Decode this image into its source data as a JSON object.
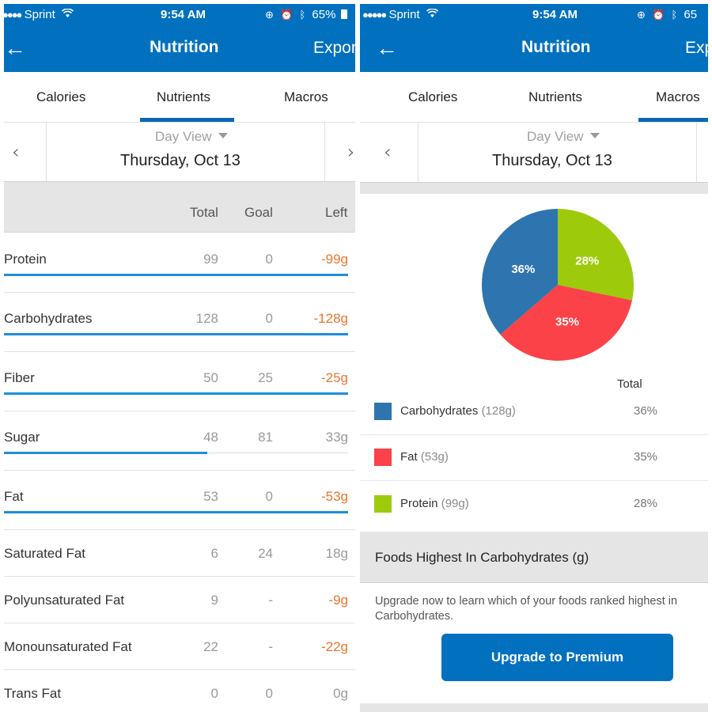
{
  "colors": {
    "brand": "#0070bf",
    "negative": "#e8762d",
    "progress": "#1e8ed8",
    "carbs": "#2e74ae",
    "fat": "#fb4248",
    "protein": "#9dcb0c"
  },
  "left_screen": {
    "status": {
      "signal_dots": "●●●●",
      "carrier": "Sprint",
      "time": "9:54 AM",
      "icons": [
        "rotation-lock-icon",
        "alarm-icon",
        "bluetooth-icon"
      ],
      "battery": "65%"
    },
    "nav": {
      "back_icon": "←",
      "title": "Nutrition",
      "action": "Expor"
    },
    "tabs": [
      {
        "label": "Calories",
        "active": false
      },
      {
        "label": "Nutrients",
        "active": true
      },
      {
        "label": "Macros",
        "active": false
      }
    ],
    "date_nav": {
      "prev": "‹",
      "next": "›",
      "view": "Day View",
      "date": "Thursday, Oct 13"
    },
    "table": {
      "headers": {
        "total": "Total",
        "goal": "Goal",
        "left": "Left"
      },
      "rows": [
        {
          "name": "Protein",
          "total": "99",
          "goal": "0",
          "left": "-99g",
          "over": true,
          "progress": 1.0,
          "bar": true
        },
        {
          "name": "Carbohydrates",
          "total": "128",
          "goal": "0",
          "left": "-128g",
          "over": true,
          "progress": 1.0,
          "bar": true
        },
        {
          "name": "Fiber",
          "total": "50",
          "goal": "25",
          "left": "-25g",
          "over": true,
          "progress": 1.0,
          "bar": true
        },
        {
          "name": "Sugar",
          "total": "48",
          "goal": "81",
          "left": "33g",
          "over": false,
          "progress": 0.59,
          "bar": true
        },
        {
          "name": "Fat",
          "total": "53",
          "goal": "0",
          "left": "-53g",
          "over": true,
          "progress": 1.0,
          "bar": true
        },
        {
          "name": "Saturated Fat",
          "total": "6",
          "goal": "24",
          "left": "18g",
          "over": false,
          "bar": false
        },
        {
          "name": "Polyunsaturated Fat",
          "total": "9",
          "goal": "-",
          "left": "-9g",
          "over": true,
          "bar": false
        },
        {
          "name": "Monounsaturated Fat",
          "total": "22",
          "goal": "-",
          "left": "-22g",
          "over": true,
          "bar": false
        },
        {
          "name": "Trans Fat",
          "total": "0",
          "goal": "0",
          "left": "0g",
          "over": false,
          "bar": false
        }
      ]
    }
  },
  "right_screen": {
    "status": {
      "signal_dots": "●●●●●",
      "carrier": "Sprint",
      "time": "9:54 AM",
      "icons": [
        "rotation-lock-icon",
        "alarm-icon",
        "bluetooth-icon"
      ],
      "battery": "65"
    },
    "nav": {
      "back_icon": "←",
      "title": "Nutrition",
      "action": "Exp"
    },
    "tabs": [
      {
        "label": "Calories",
        "active": false
      },
      {
        "label": "Nutrients",
        "active": false
      },
      {
        "label": "Macros",
        "active": true
      }
    ],
    "date_nav": {
      "prev": "‹",
      "view": "Day View",
      "date": "Thursday, Oct 13"
    },
    "legend_header": "Total",
    "legend": [
      {
        "name": "Carbohydrates",
        "grams": "(128g)",
        "percent": "36%"
      },
      {
        "name": "Fat",
        "grams": "(53g)",
        "percent": "35%"
      },
      {
        "name": "Protein",
        "grams": "(99g)",
        "percent": "28%"
      }
    ],
    "foods_title": "Foods Highest In Carbohydrates (g)",
    "upsell_text": "Upgrade now to learn which of your foods ranked highest in Carbohydrates.",
    "premium_button": "Upgrade to Premium"
  },
  "chart_data": {
    "type": "pie",
    "title": "",
    "slices": [
      {
        "label": "Protein",
        "value": 28,
        "display": "28%",
        "color": "#9dcb0c"
      },
      {
        "label": "Fat",
        "value": 35,
        "display": "35%",
        "color": "#fb4248"
      },
      {
        "label": "Carbohydrates",
        "value": 36,
        "display": "36%",
        "color": "#2e74ae"
      }
    ],
    "start": "12 o'clock, clockwise",
    "legend_position": "bottom"
  }
}
